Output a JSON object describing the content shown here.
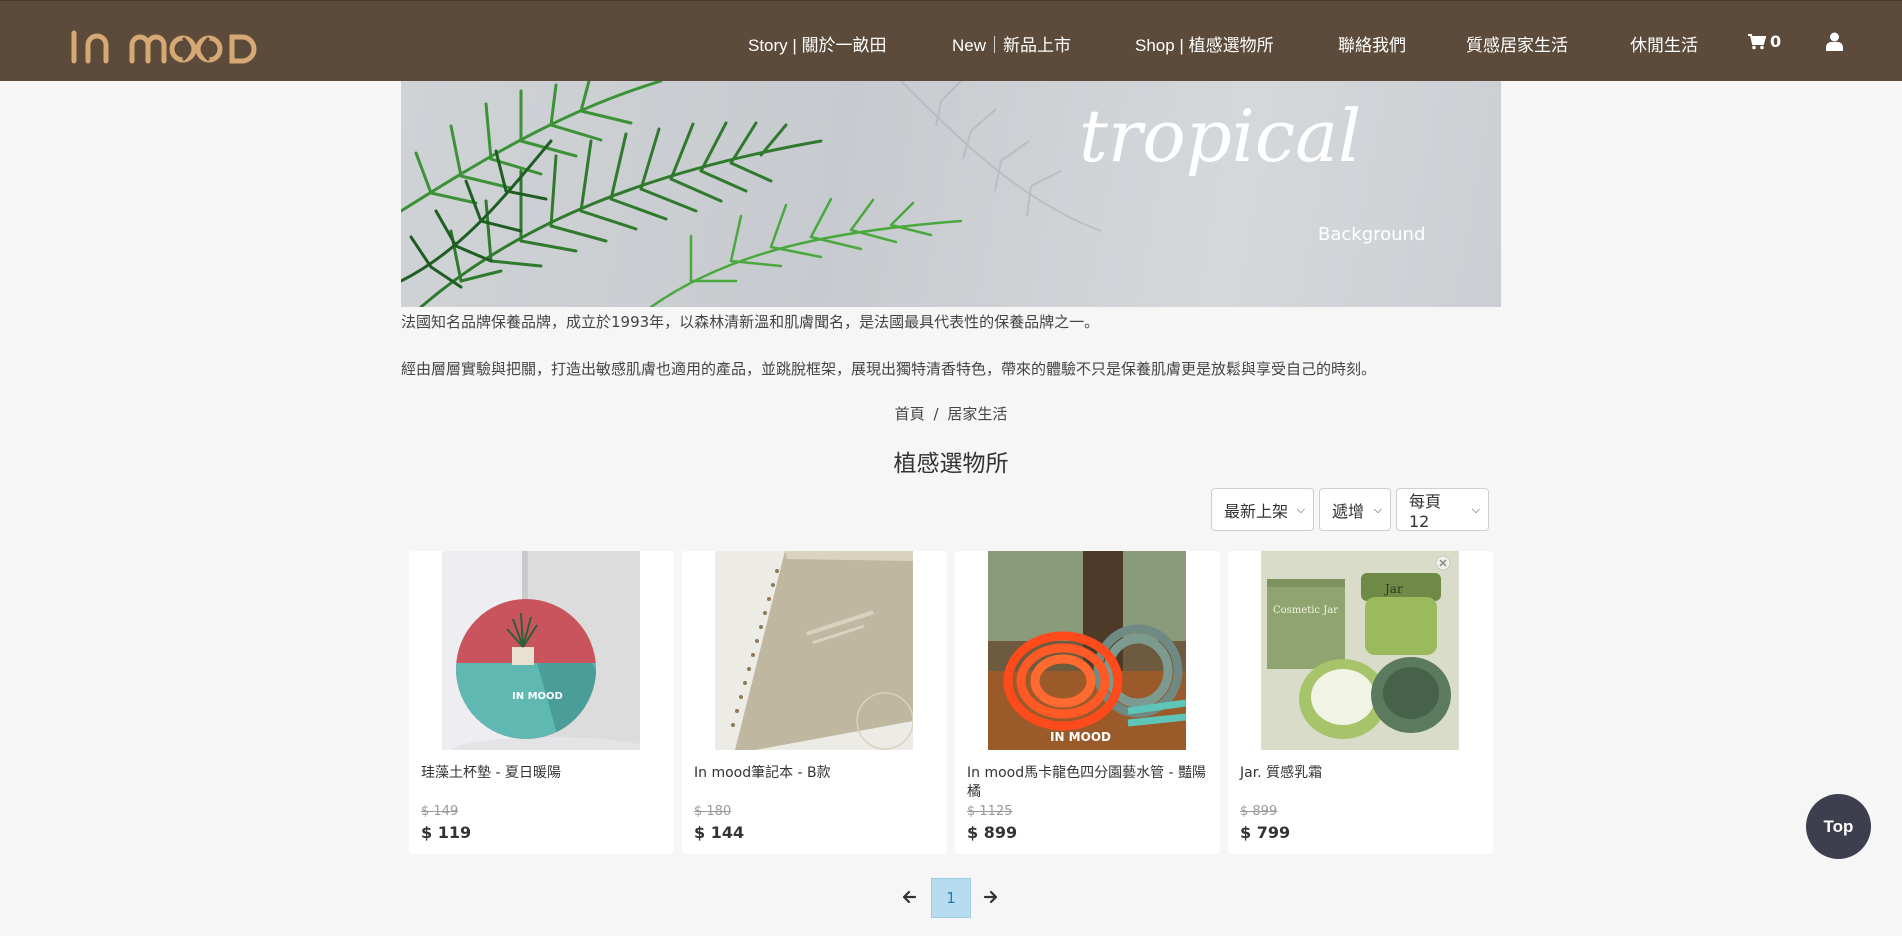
{
  "brand": {
    "logo_text": "IN MOOD"
  },
  "nav": {
    "items": [
      {
        "label": "Story | 關於一畝田"
      },
      {
        "label": "New｜新品上市"
      },
      {
        "label": "Shop | 植感選物所"
      },
      {
        "label": "聯絡我們"
      },
      {
        "label": "質感居家生活"
      },
      {
        "label": "休閒生活"
      }
    ],
    "cart_count": "0"
  },
  "banner": {
    "script_text": "tropical",
    "sub_text": "Background"
  },
  "intro": {
    "line1": "法國知名品牌保養品牌，成立於1993年，以森林清新溫和肌膚聞名，是法國最具代表性的保養品牌之一。",
    "line2": "經由層層實驗與把關，打造出敏感肌膚也適用的產品，並跳脫框架，展現出獨特清香特色，帶來的體驗不只是保養肌膚更是放鬆與享受自己的時刻。"
  },
  "breadcrumb": {
    "home": "首頁",
    "separator": "/",
    "current": "居家生活"
  },
  "page_title": "植感選物所",
  "filters": {
    "sort": "最新上架",
    "filter": "遞增",
    "per_page": "每頁 12"
  },
  "products": [
    {
      "name": "珪藻土杯墊 - 夏日暖陽",
      "old_price": "$ 149",
      "price": "$ 119"
    },
    {
      "name": "In mood筆記本 - B款",
      "old_price": "$ 180",
      "price": "$ 144"
    },
    {
      "name": "In mood馬卡龍色四分園藝水管 - 豔陽橘",
      "old_price": "$ 1125",
      "price": "$ 899"
    },
    {
      "name": "Jar. 質感乳霜",
      "old_price": "$ 899",
      "price": "$ 799"
    }
  ],
  "product_image_text": {
    "coaster_logo": "IN MOOD",
    "hose_logo": "IN MOOD",
    "jar_box_brand": "Cosmetic Jar",
    "jar_lid_brand": "Jar"
  },
  "pagination": {
    "current_page": "1"
  },
  "top_button": {
    "label": "Top"
  },
  "colors": {
    "header_bg": "#5c4b3b",
    "logo_gold": "#d6a874",
    "page_bg": "#f6f6f6",
    "active_page": "#b7dcef",
    "top_btn": "#3d3f4f"
  }
}
